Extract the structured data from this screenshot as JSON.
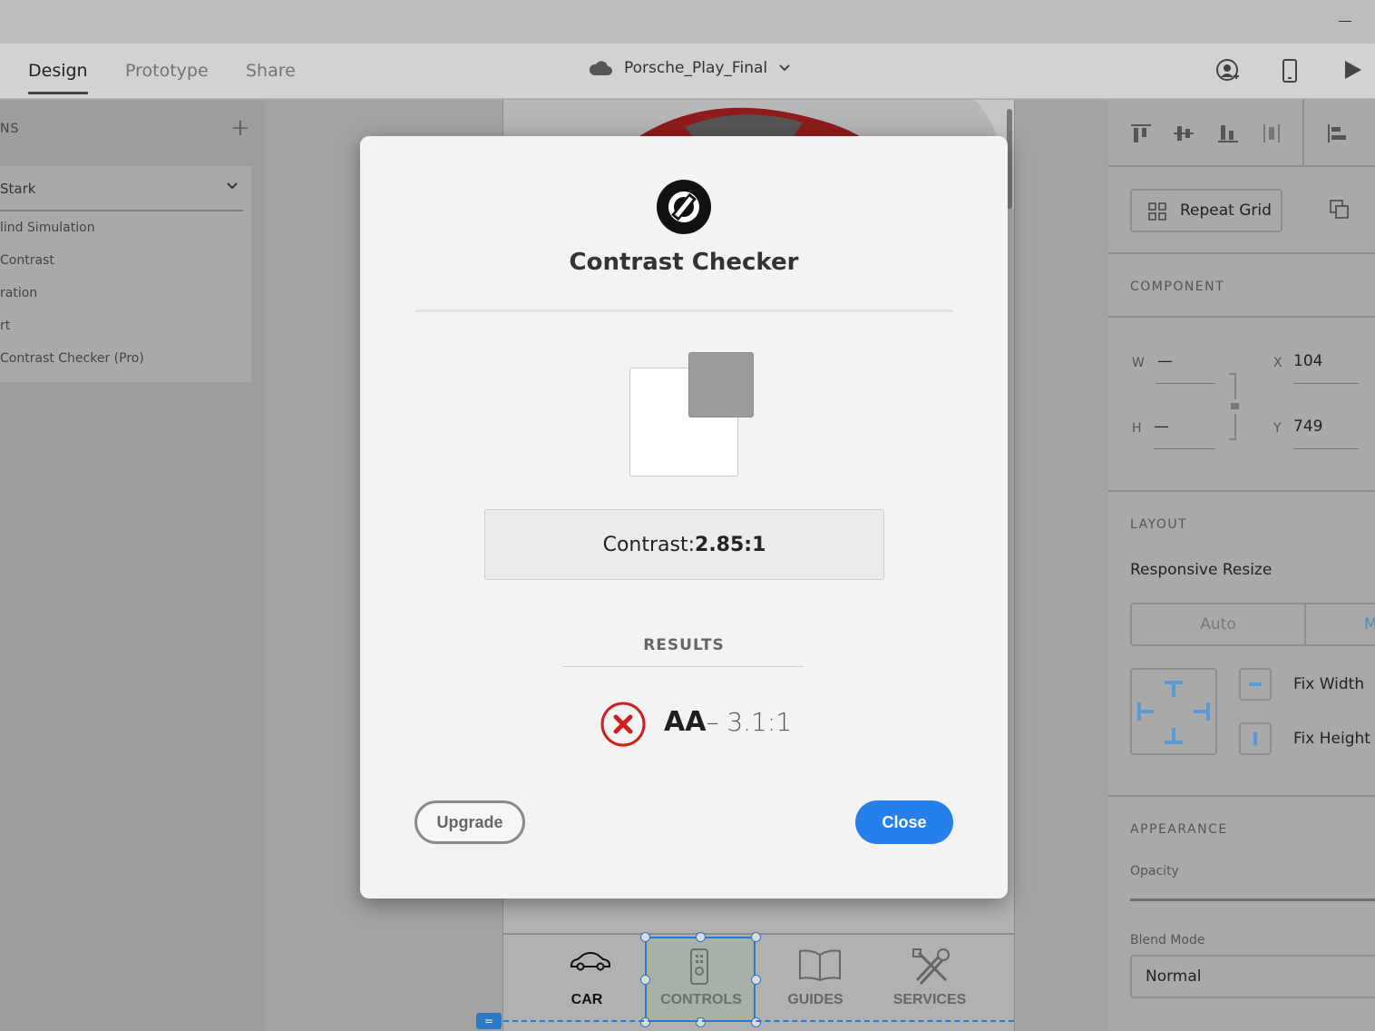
{
  "app": {
    "tabs": [
      {
        "label": "Design",
        "active": true
      },
      {
        "label": "Prototype",
        "active": false
      },
      {
        "label": "Share",
        "active": false
      }
    ],
    "document_title": "Porsche_Play_Final",
    "icons": [
      "cloud-icon",
      "share-user-icon",
      "mobile-preview-icon",
      "play-icon",
      "minimize-icon"
    ]
  },
  "left_panel": {
    "header": "NS",
    "plugin": {
      "name": "Stark",
      "items": [
        "lind Simulation",
        "Contrast",
        "ration",
        "rt",
        "Contrast Checker (Pro)"
      ]
    }
  },
  "artboard": {
    "nav_items": [
      {
        "label": "CAR",
        "icon": "car-icon",
        "active": true
      },
      {
        "label": "CONTROLS",
        "icon": "remote-icon",
        "active": false,
        "selected": true
      },
      {
        "label": "GUIDES",
        "icon": "book-icon",
        "active": false
      },
      {
        "label": "SERVICES",
        "icon": "tools-icon",
        "active": false
      }
    ]
  },
  "right_panel": {
    "repeat_grid_label": "Repeat Grid",
    "component_head": "COMPONENT",
    "w_label": "W",
    "w_value": "—",
    "h_label": "H",
    "h_value": "—",
    "x_label": "X",
    "x_value": "104",
    "y_label": "Y",
    "y_value": "749",
    "layout_head": "LAYOUT",
    "responsive_resize": "Responsive Resize",
    "auto_label": "Auto",
    "manual_label": "M",
    "fix_width": "Fix Width",
    "fix_height": "Fix Height",
    "appearance_head": "APPEARANCE",
    "opacity_label": "Opacity",
    "blend_mode_label": "Blend Mode",
    "blend_mode_value": "Normal"
  },
  "modal": {
    "title": "Contrast Checker",
    "contrast_label": "Contrast:",
    "contrast_value": "2.85:1",
    "foreground_color": "#ffffff",
    "background_color": "#9b9b9b",
    "results_label": "RESULTS",
    "result": {
      "level": "AA",
      "ratio": "– 3.1:1",
      "status": "fail"
    },
    "upgrade_label": "Upgrade",
    "close_label": "Close",
    "accent_color": "#2680eb",
    "fail_color": "#cc1f1f"
  }
}
